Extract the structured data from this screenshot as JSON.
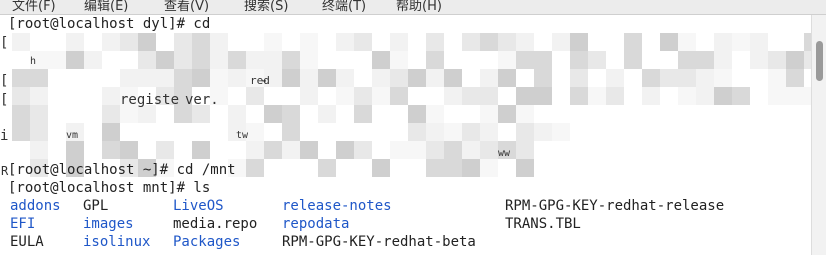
{
  "menu": {
    "items": [
      {
        "label": "文件(F)"
      },
      {
        "label": "编辑(E)"
      },
      {
        "label": "查看(V)"
      },
      {
        "label": "搜索(S)"
      },
      {
        "label": "终端(T)"
      },
      {
        "label": "帮助(H)"
      }
    ]
  },
  "terminal": {
    "lines": [
      "[root@localhost dyl]# cd",
      "[root@localhost ~]# cd /mnt",
      "[root@localhost mnt]# ls"
    ],
    "fragments": [
      "h",
      "re",
      "-",
      "red",
      "registe",
      "r.",
      "ver.",
      "vm",
      "tw",
      "ww"
    ],
    "left_edge_chars": [
      "[",
      "[",
      "[",
      "i",
      "R"
    ],
    "ls_columns": [
      [
        {
          "name": "addons",
          "type": "dir"
        },
        {
          "name": "EFI",
          "type": "dir"
        },
        {
          "name": "EULA",
          "type": "file"
        }
      ],
      [
        {
          "name": "GPL",
          "type": "file"
        },
        {
          "name": "images",
          "type": "dir"
        },
        {
          "name": "isolinux",
          "type": "dir"
        }
      ],
      [
        {
          "name": "LiveOS",
          "type": "dir"
        },
        {
          "name": "media.repo",
          "type": "file"
        },
        {
          "name": "Packages",
          "type": "dir"
        }
      ],
      [
        {
          "name": "release-notes",
          "type": "dir"
        },
        {
          "name": "repodata",
          "type": "dir"
        },
        {
          "name": "RPM-GPG-KEY-redhat-beta",
          "type": "file"
        }
      ],
      [
        {
          "name": "RPM-GPG-KEY-redhat-release",
          "type": "file"
        },
        {
          "name": "TRANS.TBL",
          "type": "file"
        }
      ]
    ]
  },
  "colors": {
    "directory": "#1f57c8",
    "text": "#222222",
    "pixelation": [
      "#d9d9d9",
      "#e8e8e8",
      "#f2f2f2",
      "#cfcfcf",
      "#f7f7f7"
    ]
  }
}
